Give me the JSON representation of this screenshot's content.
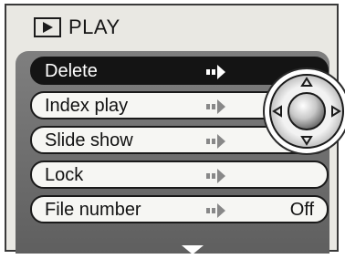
{
  "header": {
    "title": "PLAY",
    "icon": "play-icon"
  },
  "menu": {
    "items": [
      {
        "label": "Delete",
        "value": "",
        "selected": true
      },
      {
        "label": "Index play",
        "value": "",
        "selected": false
      },
      {
        "label": "Slide show",
        "value": "",
        "selected": false
      },
      {
        "label": "Lock",
        "value": "",
        "selected": false
      },
      {
        "label": "File number",
        "value": "Off",
        "selected": false
      }
    ]
  },
  "colors": {
    "selected_bg": "#141414",
    "item_bg": "#f6f6f3",
    "panel_bg": "#e9e8e3",
    "menu_bg": "#6f6f6f"
  },
  "icons": {
    "item_arrow": "arrow-right-icon",
    "scroll": "scroll-down-icon",
    "controller": "four-way-controller-icon"
  }
}
